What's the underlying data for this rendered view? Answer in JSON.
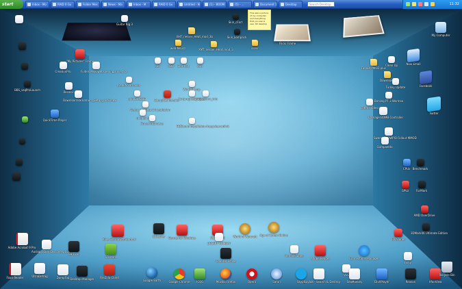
{
  "taskbar": {
    "start_label": "start",
    "tasks": [
      "Inbox - Mo",
      "RAID 0 Gu",
      "Folder Mes",
      "News - Ma",
      "Inbox - M",
      "RAID 0 Gu",
      "Untitled - N",
      "(1) - BOOM",
      "(5) - ...",
      "Document 1",
      "Desktop"
    ],
    "search_placeholder": "Search Desktop",
    "clock": "11:32"
  },
  "room": {
    "colors": {
      "back_wall": "#9fd8ef",
      "floor": "#57a8cf",
      "left_wall": "#1f5c84",
      "right_wall": "#1c5a82",
      "ceiling": "#1a4c6e"
    },
    "sticky_note": "This was a picture of my computer and everything that you see is real. 3D desktop"
  },
  "icons": {
    "left_wall": [
      {
        "name": "folder-item-1",
        "label": "",
        "kind": "g-doc"
      },
      {
        "name": "folder-item-2",
        "label": "",
        "kind": "g-dark"
      },
      {
        "name": "folder-item-3",
        "label": "",
        "kind": "g-dark"
      },
      {
        "name": "folder-item-4",
        "label": "BBS_vsqProLaunch",
        "kind": "g-dark"
      },
      {
        "name": "folder-item-5",
        "label": "",
        "kind": "g-green"
      },
      {
        "name": "folder-item-6",
        "label": "",
        "kind": "g-dark"
      },
      {
        "name": "folder-item-7",
        "label": "",
        "kind": "g-dark"
      },
      {
        "name": "folder-item-8",
        "label": "",
        "kind": "g-dark"
      }
    ],
    "back_wall": [
      {
        "label": "Guitar Rig 3",
        "kind": "g-doc"
      },
      {
        "label": "Skin_cFort",
        "kind": "g-dark"
      },
      {
        "label": "BHT_nesser_Heat_mod_3b",
        "kind": "g-folder"
      },
      {
        "label": "Skin_kompack",
        "kind": "g-dark"
      },
      {
        "label": "web-Mejicz",
        "kind": "g-folder"
      },
      {
        "label": "XMT_nesser_Heat_mod_3",
        "kind": "g-folder"
      },
      {
        "label": "icons",
        "kind": "g-folder"
      },
      {
        "label": "Flickr Frame",
        "kind": "g-photo"
      }
    ],
    "floor_top": [
      {
        "label": "\"My Pictures\" Frame",
        "kind": "g-red"
      },
      {
        "label": "CreationPro",
        "kind": "g-doc"
      },
      {
        "label": "Folder_Mse_websvening_Investka",
        "kind": "g-doc"
      },
      {
        "label": "Recolor",
        "kind": "g-doc"
      },
      {
        "label": "Download Barkatoom_Setup_click2new",
        "kind": "g-doc"
      },
      {
        "label": "cDo",
        "kind": "g-doc"
      },
      {
        "label": "sDO",
        "kind": "g-doc"
      },
      {
        "label": "Shortcut",
        "kind": "g-doc"
      },
      {
        "label": "cDo",
        "kind": "g-doc"
      },
      {
        "label": "avsaktvvarnaxoa",
        "kind": "g-doc"
      },
      {
        "label": "arkivBasDBE",
        "kind": "g-doc"
      },
      {
        "label": "WinRAR tmp",
        "kind": "g-doc"
      },
      {
        "label": "Kortprogram_Tilpaz",
        "kind": "g-doc"
      },
      {
        "label": "Firefox 3.0 Beta 5 Installation",
        "kind": "g-doc"
      },
      {
        "label": "DumpNet installer",
        "kind": "g-fz"
      },
      {
        "label": "Ninuplatform_info",
        "kind": "g-doc"
      },
      {
        "label": "Horsekifdbrowse",
        "kind": "g-doc"
      },
      {
        "label": "QuickTime Player",
        "kind": "g-blue"
      },
      {
        "label": "HDSound-installation-freepclearwnlink",
        "kind": "g-doc"
      },
      {
        "label": "unkpaint",
        "kind": "g-doc"
      }
    ],
    "right_wall": [
      {
        "label": "My Computer",
        "kind": "g-pc"
      },
      {
        "label": "New Email",
        "kind": "g-mail"
      },
      {
        "label": "Facebook",
        "kind": "g-fb"
      },
      {
        "label": "Twitter",
        "kind": "g-tw"
      },
      {
        "label": "Clean Up",
        "kind": "g-doc"
      },
      {
        "label": "Fallout PMOD plus",
        "kind": "g-folder"
      },
      {
        "label": "Downloads",
        "kind": "g-folder"
      },
      {
        "label": "Turkey Update",
        "kind": "g-doc"
      },
      {
        "label": "Benzeg PT 3 Wormso",
        "kind": "g-doc"
      },
      {
        "label": "catena video",
        "kind": "g-doc"
      },
      {
        "label": "Damage BOMB Controller",
        "kind": "g-doc"
      },
      {
        "label": "Sweep SNOWPIO Fallout MMOD",
        "kind": "g-doc"
      },
      {
        "label": "Gumpaeldo",
        "kind": "g-doc"
      },
      {
        "label": "CPUz",
        "kind": "g-blue"
      },
      {
        "label": "Benchmark",
        "kind": "g-dark"
      },
      {
        "label": "GPUz",
        "kind": "g-red"
      },
      {
        "label": "FurMark",
        "kind": "g-dark"
      },
      {
        "label": "AMD OverDrive",
        "kind": "g-red"
      },
      {
        "label": "3DMark06 Ultimate Edition",
        "kind": "g-dark"
      },
      {
        "label": "RivaTuner",
        "kind": "g-red"
      },
      {
        "label": "Fishy",
        "kind": "g-doc"
      }
    ],
    "floor_bottom": [
      {
        "label": "Adobe Acrobat 9 Pro",
        "kind": "g-pdf"
      },
      {
        "label": "Auslogic Disk Discovery Suite",
        "kind": "g-doc"
      },
      {
        "label": "99 Fixer",
        "kind": "g-dark"
      },
      {
        "label": "Foxit Reader",
        "kind": "g-pdf"
      },
      {
        "label": "UltraDefrag",
        "kind": "g-doc"
      },
      {
        "label": "DumpTop",
        "kind": "g-doc"
      },
      {
        "label": "Desktop Manager",
        "kind": "g-dark"
      },
      {
        "label": "FileZilla Client",
        "kind": "g-fz"
      },
      {
        "label": "Killer Bandwidth Control",
        "kind": "g-red"
      },
      {
        "label": "uTorrent",
        "kind": "g-utorrent"
      },
      {
        "label": "CCleaner",
        "kind": "g-dark"
      },
      {
        "label": "Games for Windows",
        "kind": "g-red"
      },
      {
        "label": "Warcraft III",
        "kind": "g-red"
      },
      {
        "label": "World of Warcraft",
        "kind": "g-wow"
      },
      {
        "label": "Age of Conan Online",
        "kind": "g-wow"
      },
      {
        "label": "Counter-Strike",
        "kind": "g-dark"
      },
      {
        "label": "DESERT COMBAT",
        "kind": "g-doc"
      },
      {
        "label": "RemoteTunes",
        "kind": "g-doc"
      },
      {
        "label": "Adobe Reader",
        "kind": "g-red"
      },
      {
        "label": "Connections Manager",
        "kind": "g-ie"
      },
      {
        "label": "VLC",
        "kind": "g-doc"
      },
      {
        "label": "Google Earth",
        "kind": "g-earth"
      },
      {
        "label": "Google Chrome",
        "kind": "g-chrome"
      },
      {
        "label": "ICQ6",
        "kind": "g-green"
      },
      {
        "label": "Mozilla Firefox",
        "kind": "g-ff"
      },
      {
        "label": "Opera",
        "kind": "g-opera"
      },
      {
        "label": "Safari",
        "kind": "g-safari"
      },
      {
        "label": "Skype",
        "kind": "g-skype"
      },
      {
        "label": "Spybot - Search & Destroy",
        "kind": "g-doc"
      },
      {
        "label": "SeaMonkey",
        "kind": "g-doc"
      },
      {
        "label": "DivXPlayer",
        "kind": "g-blue"
      },
      {
        "label": "Reason",
        "kind": "g-dark"
      },
      {
        "label": "IrfanView",
        "kind": "g-red"
      },
      {
        "label": "Recycle Bin",
        "kind": "g-bin"
      }
    ]
  }
}
